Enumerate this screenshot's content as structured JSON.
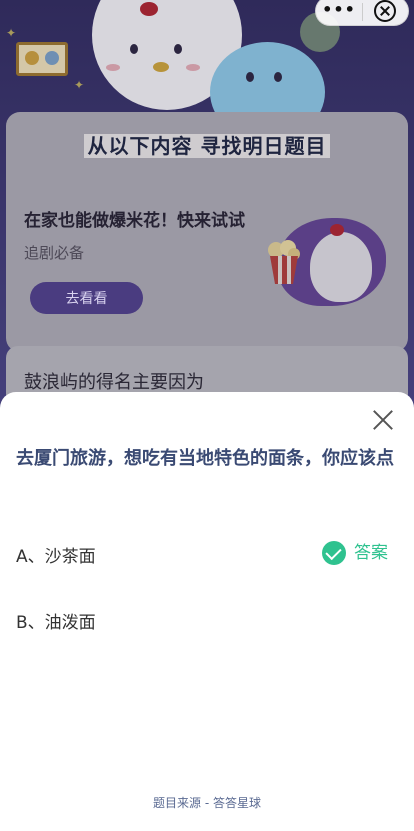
{
  "capsule": {
    "more_label": "•••"
  },
  "background": {
    "banner_title": "从以下内容  寻找明日题目",
    "promo": {
      "title": "在家也能做爆米花！快来试试",
      "subtitle": "追剧必备",
      "button_label": "去看看"
    },
    "next_card_text": "鼓浪屿的得名主要因为"
  },
  "sheet": {
    "question": "去厦门旅游，想吃有当地特色的面条，你应该点",
    "options": [
      {
        "label": "A、沙茶面",
        "is_answer": true
      },
      {
        "label": "B、油泼面",
        "is_answer": false
      }
    ],
    "answer_badge": "答案",
    "source": "题目来源 - 答答星球"
  },
  "colors": {
    "accent_green": "#2fc28f",
    "question_blue": "#3a4a73",
    "button_purple": "#4a3c80"
  },
  "icons": [
    "more-dots-icon",
    "capsule-close-icon",
    "sheet-close-icon",
    "check-circle-icon"
  ]
}
